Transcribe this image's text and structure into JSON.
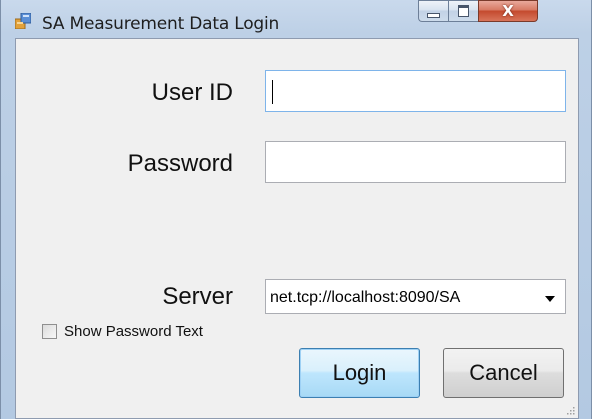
{
  "window": {
    "title": "SA Measurement Data Login",
    "icon": "app-form-icon",
    "controls": {
      "minimize_icon": "minimize-icon",
      "maximize_icon": "maximize-icon",
      "close_glyph": "X"
    }
  },
  "form": {
    "user_id": {
      "label": "User ID",
      "value": ""
    },
    "password": {
      "label": "Password",
      "value": ""
    },
    "server": {
      "label": "Server",
      "selected": "net.tcp://localhost:8090/SA"
    },
    "show_password": {
      "label": "Show Password Text",
      "checked": false
    },
    "buttons": {
      "login": "Login",
      "cancel": "Cancel"
    }
  },
  "colors": {
    "client_background": "#f0f0f0",
    "frame": "#b3c9e2",
    "close_button": "#c44a2e",
    "default_button_border": "#3c7fb1"
  }
}
